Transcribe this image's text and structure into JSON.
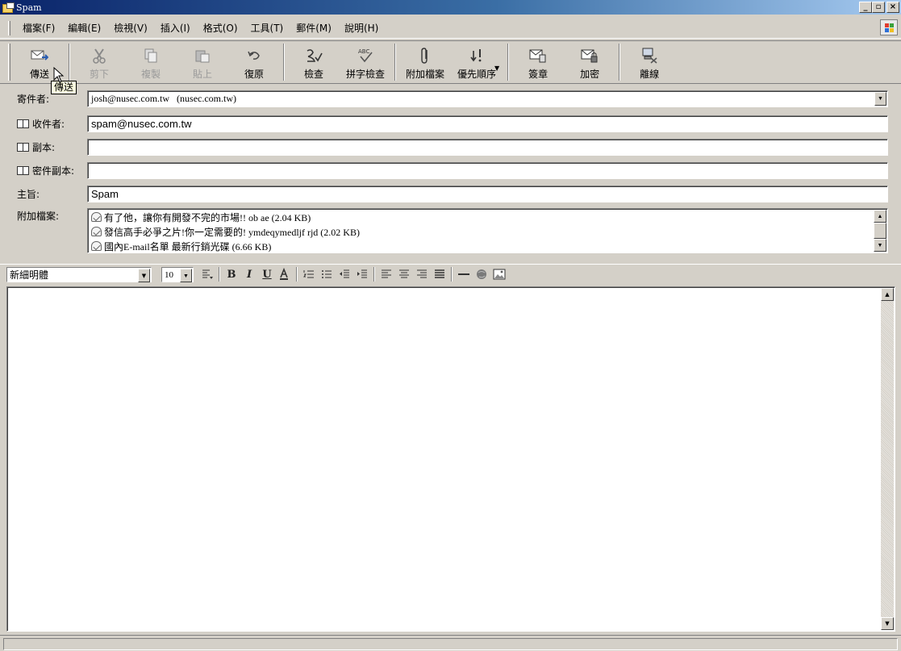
{
  "window": {
    "title": "Spam",
    "controls": [
      "_",
      "▫",
      "×"
    ]
  },
  "menu": [
    "檔案(F)",
    "編輯(E)",
    "檢視(V)",
    "插入(I)",
    "格式(O)",
    "工具(T)",
    "郵件(M)",
    "說明(H)"
  ],
  "toolbar": {
    "buttons": [
      {
        "label": "傳送",
        "icon": "send-icon",
        "enabled": true
      },
      {
        "label": "剪下",
        "icon": "cut-icon",
        "enabled": false
      },
      {
        "label": "複製",
        "icon": "copy-icon",
        "enabled": false
      },
      {
        "label": "貼上",
        "icon": "paste-icon",
        "enabled": false
      },
      {
        "label": "復原",
        "icon": "undo-icon",
        "enabled": true
      },
      {
        "label": "檢查",
        "icon": "check-names-icon",
        "enabled": true
      },
      {
        "label": "拼字檢查",
        "icon": "spelling-icon",
        "enabled": true
      },
      {
        "label": "附加檔案",
        "icon": "attach-icon",
        "enabled": true
      },
      {
        "label": "優先順序",
        "icon": "priority-icon",
        "enabled": true
      },
      {
        "label": "簽章",
        "icon": "sign-icon",
        "enabled": true
      },
      {
        "label": "加密",
        "icon": "encrypt-icon",
        "enabled": true
      },
      {
        "label": "離線",
        "icon": "offline-icon",
        "enabled": true
      }
    ],
    "tooltip": "傳送"
  },
  "header": {
    "from_label": "寄件者:",
    "from_value": "josh@nusec.com.tw   (nusec.com.tw)",
    "to_label": "收件者:",
    "to_value": "spam@nusec.com.tw",
    "cc_label": "副本:",
    "cc_value": "",
    "bcc_label": "密件副本:",
    "bcc_value": "",
    "subject_label": "主旨:",
    "subject_value": "Spam",
    "attach_label": "附加檔案:",
    "attachments": [
      "有了他，讓你有開發不完的市場!! ob ae (2.04 KB)",
      "發信高手必爭之片!你一定需要的! ymdeqymedljf rjd (2.02 KB)",
      "國內E-mail名單 最新行銷光碟 (6.66 KB)"
    ]
  },
  "format": {
    "font": "新細明體",
    "size": "10"
  },
  "body": {
    "text": ""
  }
}
